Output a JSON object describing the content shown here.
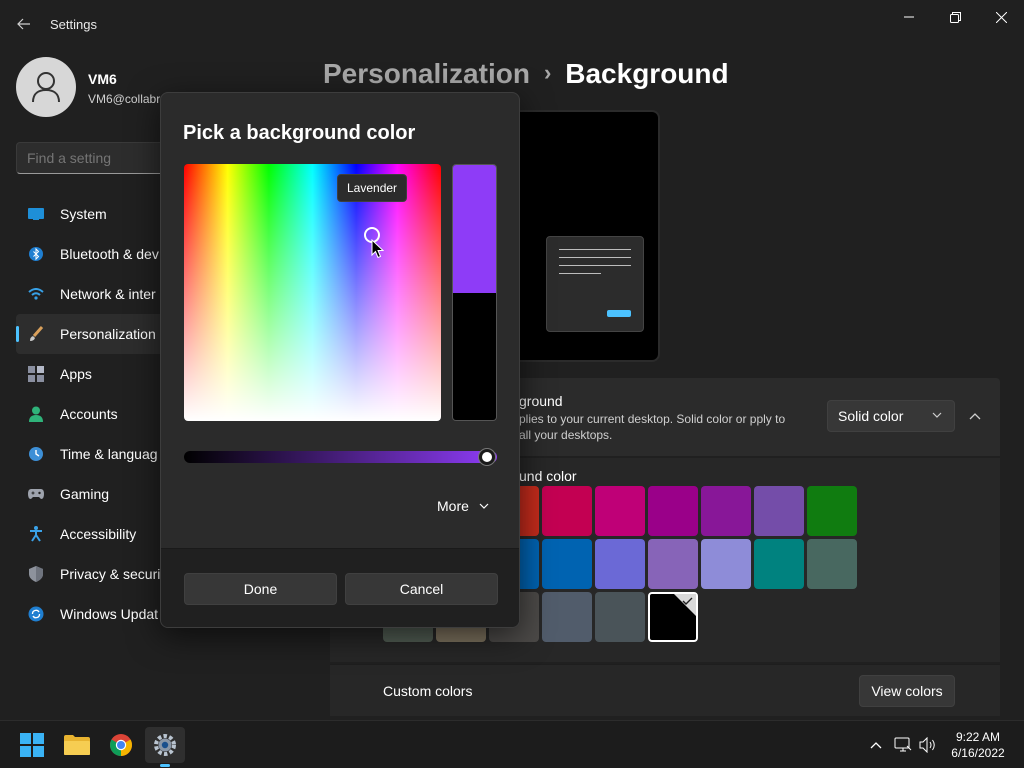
{
  "app": {
    "title": "Settings"
  },
  "user": {
    "name": "VM6",
    "email": "VM6@collabr"
  },
  "search": {
    "placeholder": "Find a setting"
  },
  "sidebar": {
    "items": [
      {
        "label": "System",
        "icon": "system-icon"
      },
      {
        "label": "Bluetooth & dev",
        "icon": "bluetooth-icon"
      },
      {
        "label": "Network & inter",
        "icon": "wifi-icon"
      },
      {
        "label": "Personalization",
        "icon": "brush-icon",
        "active": true
      },
      {
        "label": "Apps",
        "icon": "apps-icon"
      },
      {
        "label": "Accounts",
        "icon": "accounts-icon"
      },
      {
        "label": "Time & languag",
        "icon": "time-language-icon"
      },
      {
        "label": "Gaming",
        "icon": "gamepad-icon"
      },
      {
        "label": "Accessibility",
        "icon": "accessibility-icon"
      },
      {
        "label": "Privacy & securit",
        "icon": "shield-icon"
      },
      {
        "label": "Windows Updat",
        "icon": "update-icon"
      }
    ]
  },
  "breadcrumb": {
    "parent": "Personalization",
    "separator": "›",
    "current": "Background"
  },
  "background_setting": {
    "title": "ground",
    "description": "plies to your current desktop. Solid color or pply to all your desktops.",
    "dropdown_value": "Solid color"
  },
  "colors_section": {
    "title": "und color",
    "swatches": [
      [
        "#c42b1c",
        "#c30052",
        "#bf0077",
        "#9a0089",
        "#881798",
        "#744da9",
        "#107c10"
      ],
      [
        "#0063b1",
        "#0063b1",
        "#6b69d6",
        "#8764b8",
        "#8e8cd8",
        "#00827f",
        "#486860"
      ],
      [
        "#525e54",
        "#7e735f",
        "#4c4a48",
        "#515c6b",
        "#4a5459",
        "#000000"
      ]
    ],
    "selected_color": "#000000"
  },
  "custom_colors": {
    "label": "Custom colors",
    "button": "View colors"
  },
  "dialog": {
    "title": "Pick a background color",
    "tooltip": "Lavender",
    "new_color": "#8e3cf7",
    "current_color": "#000000",
    "brightness_percent": 100,
    "more_label": "More",
    "done_label": "Done",
    "cancel_label": "Cancel"
  },
  "taskbar": {
    "apps": [
      "start-icon",
      "file-explorer-icon",
      "chrome-icon",
      "settings-icon"
    ],
    "time": "9:22 AM",
    "date": "6/16/2022"
  },
  "colors": {
    "accent": "#4cc2ff",
    "window_bg": "#202020",
    "card_bg": "#2b2b2b"
  }
}
